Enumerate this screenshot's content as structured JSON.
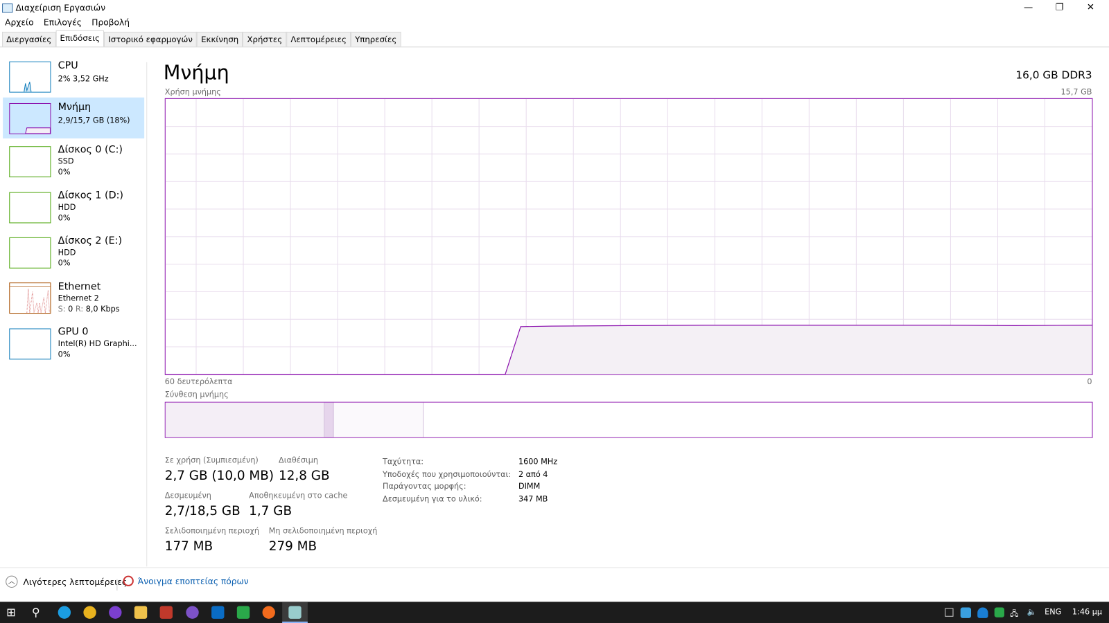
{
  "window": {
    "title": "Διαχείριση Εργασιών",
    "minimize": "—",
    "maximize": "❐",
    "close": "✕"
  },
  "menu": [
    "Αρχείο",
    "Επιλογές",
    "Προβολή"
  ],
  "tabs": [
    "Διεργασίες",
    "Επιδόσεις",
    "Ιστορικό εφαρμογών",
    "Εκκίνηση",
    "Χρήστες",
    "Λεπτομέρειες",
    "Υπηρεσίες"
  ],
  "active_tab": 1,
  "sidebar": [
    {
      "name": "CPU",
      "line1": "2% 3,52 GHz",
      "color": "#117dbb"
    },
    {
      "name": "Μνήμη",
      "line1": "2,9/15,7 GB (18%)",
      "color": "#8b12ae"
    },
    {
      "name": "Δίσκος 0 (C:)",
      "line1": "SSD",
      "line2": "0%",
      "color": "#4da60c"
    },
    {
      "name": "Δίσκος 1 (D:)",
      "line1": "HDD",
      "line2": "0%",
      "color": "#4da60c"
    },
    {
      "name": "Δίσκος 2 (E:)",
      "line1": "HDD",
      "line2": "0%",
      "color": "#4da60c"
    },
    {
      "name": "Ethernet",
      "line1": "Ethernet 2",
      "s_label": "S:",
      "s_val": "0",
      "r_label": "R:",
      "r_val": "8,0 Kbps",
      "color": "#a74f01"
    },
    {
      "name": "GPU 0",
      "line1": "Intel(R) HD Graphi...",
      "line2": "0%",
      "color": "#117dbb"
    }
  ],
  "main": {
    "heading": "Μνήμη",
    "total": "16,0 GB DDR3",
    "usage_label": "Χρήση μνήμης",
    "usage_max": "15,7 GB",
    "time_left": "60 δευτερόλεπτα",
    "time_right": "0",
    "composition_label": "Σύνθεση μνήμης",
    "stats": {
      "in_use_label": "Σε χρήση (Συμπιεσμένη)",
      "in_use": "2,7 GB (10,0 MB)",
      "available_label": "Διαθέσιμη",
      "available": "12,8 GB",
      "committed_label": "Δεσμευμένη",
      "committed": "2,7/18,5 GB",
      "cached_label": "Αποθηκευμένη στο cache",
      "cached": "1,7 GB",
      "paged_label": "Σελιδοποιημένη περιοχή",
      "paged": "177 MB",
      "nonpaged_label": "Μη σελιδοποιημένη περιοχή",
      "nonpaged": "279 MB"
    },
    "kv": [
      {
        "k": "Ταχύτητα:",
        "v": "1600 MHz"
      },
      {
        "k": "Υποδοχές που χρησιμοποιούνται:",
        "v": "2 από 4"
      },
      {
        "k": "Παράγοντας μορφής:",
        "v": "DIMM"
      },
      {
        "k": "Δεσμευμένη για το υλικό:",
        "v": "347 MB"
      }
    ]
  },
  "chart_data": {
    "type": "area",
    "title": "Χρήση μνήμης",
    "ylim": [
      0,
      15.7
    ],
    "xlim": [
      60,
      0
    ],
    "xlabel": "60 δευτερόλεπτα",
    "grid": true,
    "seconds_ago": [
      60,
      50,
      40,
      38,
      37,
      35,
      30,
      25,
      20,
      15,
      10,
      5,
      0
    ],
    "values_gb": [
      0,
      0,
      0,
      0,
      2.72,
      2.75,
      2.78,
      2.8,
      2.8,
      2.8,
      2.8,
      2.78,
      2.8
    ],
    "composition_fractions": {
      "in_use": 0.172,
      "modified": 0.01,
      "standby": 0.097,
      "free": 0.721
    }
  },
  "footer": {
    "fewer": "Λιγότερες λεπτομέρειες",
    "monitor": "Άνοιγμα εποπτείας πόρων"
  },
  "taskbar": {
    "lang": "ENG",
    "time": "1:46 μμ"
  },
  "colors": {
    "accent": "#8b12ae",
    "selected": "#cce8ff"
  }
}
